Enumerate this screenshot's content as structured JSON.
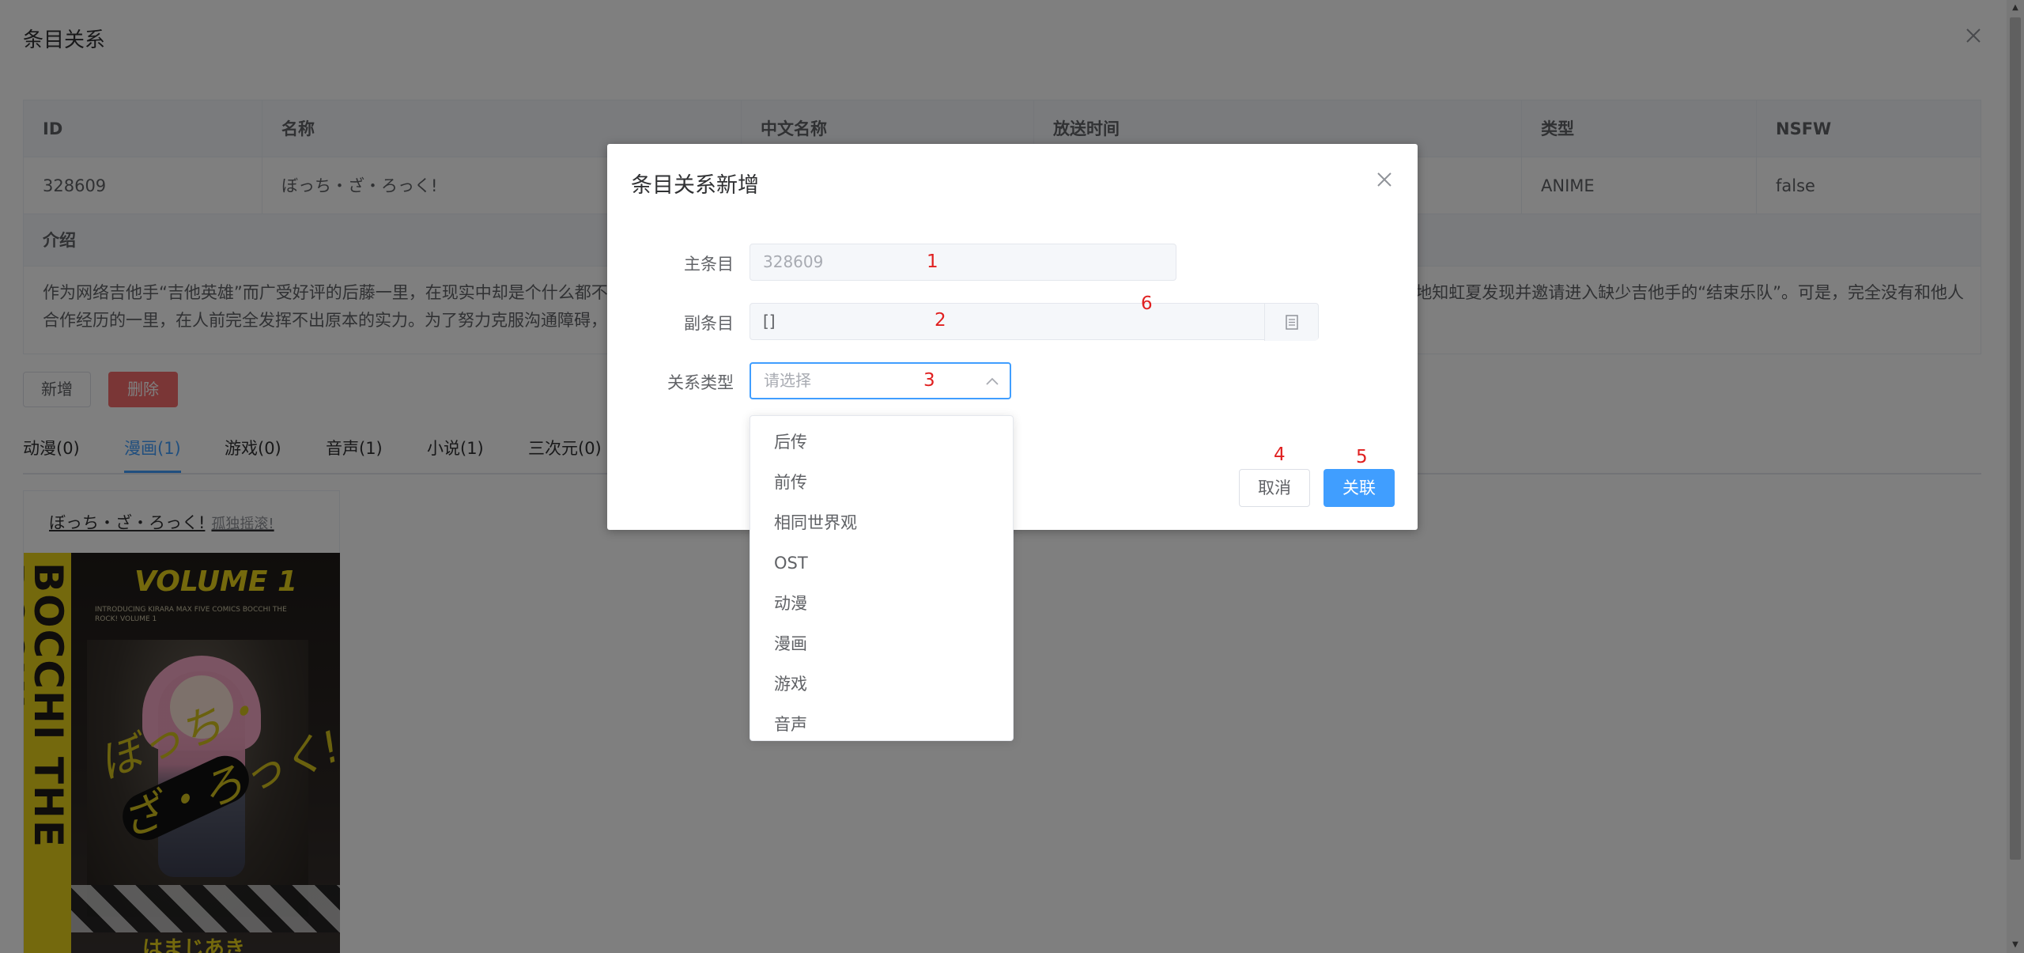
{
  "outer_dialog": {
    "title": "条目关系",
    "close_icon": "close-icon"
  },
  "detail_table": {
    "headers": [
      "ID",
      "名称",
      "中文名称",
      "放送时间",
      "类型",
      "NSFW"
    ],
    "row": [
      "328609",
      "ぼっち・ざ・ろっく!",
      "",
      "",
      "ANIME",
      "false"
    ],
    "intro_header": "介绍",
    "intro_line1_left": "作为网络吉他手“吉他英雄”而广受好评的后藤一里，在现实中却是个什么都不会",
    "intro_line1_right": "地知虹夏发现并邀请进入缺少吉他手的“结束乐队”。可是，完全没有和他人",
    "intro_line2": "合作经历的一里，在人前完全发挥不出原本的实力。为了努力克服沟通障碍，"
  },
  "actions": {
    "add_label": "新增",
    "delete_label": "删除"
  },
  "tabs": [
    {
      "label": "动漫(0)"
    },
    {
      "label": "漫画(1)"
    },
    {
      "label": "游戏(0)"
    },
    {
      "label": "音声(1)"
    },
    {
      "label": "小说(1)"
    },
    {
      "label": "三次元(0)"
    }
  ],
  "active_tab": "漫画(1)",
  "card": {
    "title": "ぼっち・ざ・ろっく!",
    "subtitle": "孤独摇滚!",
    "cover": {
      "volume": "VOLUME 1",
      "side_text": "BOCCHI THE ROCK!",
      "small_text": "INTRODUCING KIRARA MAX FIVE COMICS BOCCHI THE ROCK! VOLUME 1",
      "script_text": "ぼっち・ざ・ろっく!",
      "bottom_text": "はまじあき"
    }
  },
  "dialog": {
    "title": "条目关系新增",
    "close_icon": "close-icon",
    "main_label": "主条目",
    "main_value": "328609",
    "sub_label": "副条目",
    "sub_value": "[]",
    "sub_append_icon": "document-icon",
    "relation_label": "关系类型",
    "relation_placeholder": "请选择",
    "relation_arrow_icon": "chevron-up-icon",
    "cancel_label": "取消",
    "link_label": "关联",
    "markers": [
      "1",
      "2",
      "3",
      "4",
      "5",
      "6"
    ]
  },
  "dropdown": {
    "options": [
      "后传",
      "前传",
      "相同世界观",
      "OST",
      "动漫",
      "漫画",
      "游戏",
      "音声"
    ]
  },
  "colors": {
    "primary": "#409eff",
    "danger": "#f56c6c",
    "marker": "#e02020",
    "overlay": "rgba(0,0,0,0.5)"
  }
}
